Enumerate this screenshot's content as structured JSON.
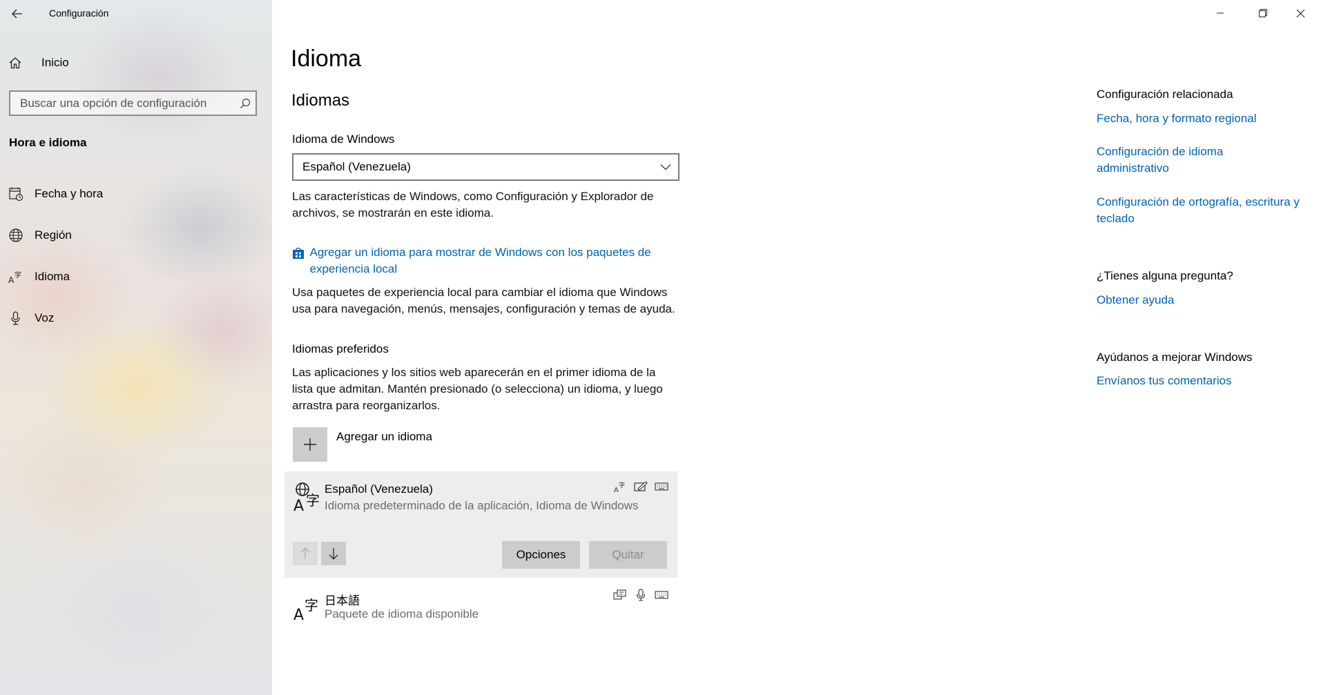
{
  "window": {
    "title": "Configuración",
    "controls": {
      "minimize": "minimize-icon",
      "restore": "restore-icon",
      "close": "close-icon"
    }
  },
  "sidebar": {
    "home_label": "Inicio",
    "search_placeholder": "Buscar una opción de configuración",
    "section_heading": "Hora e idioma",
    "items": [
      {
        "label": "Fecha y hora",
        "icon": "calendar-clock-icon"
      },
      {
        "label": "Región",
        "icon": "globe-icon"
      },
      {
        "label": "Idioma",
        "icon": "language-icon",
        "selected": true
      },
      {
        "label": "Voz",
        "icon": "microphone-icon"
      }
    ]
  },
  "main": {
    "title": "Idioma",
    "subtitle": "Idiomas",
    "windows_language_label": "Idioma de Windows",
    "windows_language_value": "Español (Venezuela)",
    "windows_language_desc": "Las características de Windows, como Configuración y Explorador de archivos, se mostrarán en este idioma.",
    "store_link": "Agregar un idioma para mostrar de Windows con los paquetes de experiencia local",
    "store_desc": "Usa paquetes de experiencia local para cambiar el idioma que Windows usa para navegación, menús, mensajes, configuración y temas de ayuda.",
    "preferred_heading": "Idiomas preferidos",
    "preferred_desc": "Las aplicaciones y los sitios web aparecerán en el primer idioma de la lista que admitan. Mantén presionado (o selecciona) un idioma, y luego arrastra para reorganizarlos.",
    "add_language": "Agregar un idioma",
    "languages": [
      {
        "name": "Español (Venezuela)",
        "desc": "Idioma predeterminado de la aplicación, Idioma de Windows",
        "features": [
          "display-language-icon",
          "handwriting-icon",
          "keyboard-icon"
        ]
      },
      {
        "name": "日本語",
        "desc": "Paquete de idioma disponible",
        "features": [
          "text-to-speech-icon",
          "microphone-icon",
          "keyboard-icon"
        ]
      }
    ],
    "options_button": "Opciones",
    "remove_button": "Quitar"
  },
  "related": {
    "heading": "Configuración relacionada",
    "links": [
      "Fecha, hora y formato regional",
      "Configuración de idioma administrativo",
      "Configuración de ortografía, escritura y teclado"
    ],
    "question_heading": "¿Tienes alguna pregunta?",
    "help_link": "Obtener ayuda",
    "improve_heading": "Ayúdanos a mejorar Windows",
    "feedback_link": "Envíanos tus comentarios"
  },
  "colors": {
    "accent": "#0063b1",
    "selected_row": "#ededed",
    "button": "#cccccc"
  }
}
